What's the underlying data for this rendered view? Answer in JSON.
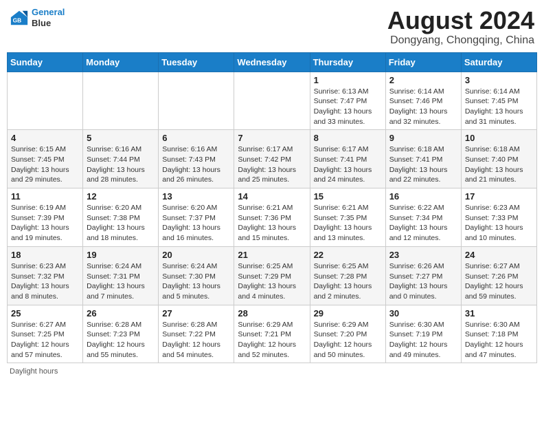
{
  "header": {
    "logo_line1": "General",
    "logo_line2": "Blue",
    "title": "August 2024",
    "subtitle": "Dongyang, Chongqing, China"
  },
  "days_of_week": [
    "Sunday",
    "Monday",
    "Tuesday",
    "Wednesday",
    "Thursday",
    "Friday",
    "Saturday"
  ],
  "footer": {
    "note": "Daylight hours"
  },
  "weeks": [
    [
      {
        "day": "",
        "info": ""
      },
      {
        "day": "",
        "info": ""
      },
      {
        "day": "",
        "info": ""
      },
      {
        "day": "",
        "info": ""
      },
      {
        "day": "1",
        "info": "Sunrise: 6:13 AM\nSunset: 7:47 PM\nDaylight: 13 hours and 33 minutes."
      },
      {
        "day": "2",
        "info": "Sunrise: 6:14 AM\nSunset: 7:46 PM\nDaylight: 13 hours and 32 minutes."
      },
      {
        "day": "3",
        "info": "Sunrise: 6:14 AM\nSunset: 7:45 PM\nDaylight: 13 hours and 31 minutes."
      }
    ],
    [
      {
        "day": "4",
        "info": "Sunrise: 6:15 AM\nSunset: 7:45 PM\nDaylight: 13 hours and 29 minutes."
      },
      {
        "day": "5",
        "info": "Sunrise: 6:16 AM\nSunset: 7:44 PM\nDaylight: 13 hours and 28 minutes."
      },
      {
        "day": "6",
        "info": "Sunrise: 6:16 AM\nSunset: 7:43 PM\nDaylight: 13 hours and 26 minutes."
      },
      {
        "day": "7",
        "info": "Sunrise: 6:17 AM\nSunset: 7:42 PM\nDaylight: 13 hours and 25 minutes."
      },
      {
        "day": "8",
        "info": "Sunrise: 6:17 AM\nSunset: 7:41 PM\nDaylight: 13 hours and 24 minutes."
      },
      {
        "day": "9",
        "info": "Sunrise: 6:18 AM\nSunset: 7:41 PM\nDaylight: 13 hours and 22 minutes."
      },
      {
        "day": "10",
        "info": "Sunrise: 6:18 AM\nSunset: 7:40 PM\nDaylight: 13 hours and 21 minutes."
      }
    ],
    [
      {
        "day": "11",
        "info": "Sunrise: 6:19 AM\nSunset: 7:39 PM\nDaylight: 13 hours and 19 minutes."
      },
      {
        "day": "12",
        "info": "Sunrise: 6:20 AM\nSunset: 7:38 PM\nDaylight: 13 hours and 18 minutes."
      },
      {
        "day": "13",
        "info": "Sunrise: 6:20 AM\nSunset: 7:37 PM\nDaylight: 13 hours and 16 minutes."
      },
      {
        "day": "14",
        "info": "Sunrise: 6:21 AM\nSunset: 7:36 PM\nDaylight: 13 hours and 15 minutes."
      },
      {
        "day": "15",
        "info": "Sunrise: 6:21 AM\nSunset: 7:35 PM\nDaylight: 13 hours and 13 minutes."
      },
      {
        "day": "16",
        "info": "Sunrise: 6:22 AM\nSunset: 7:34 PM\nDaylight: 13 hours and 12 minutes."
      },
      {
        "day": "17",
        "info": "Sunrise: 6:23 AM\nSunset: 7:33 PM\nDaylight: 13 hours and 10 minutes."
      }
    ],
    [
      {
        "day": "18",
        "info": "Sunrise: 6:23 AM\nSunset: 7:32 PM\nDaylight: 13 hours and 8 minutes."
      },
      {
        "day": "19",
        "info": "Sunrise: 6:24 AM\nSunset: 7:31 PM\nDaylight: 13 hours and 7 minutes."
      },
      {
        "day": "20",
        "info": "Sunrise: 6:24 AM\nSunset: 7:30 PM\nDaylight: 13 hours and 5 minutes."
      },
      {
        "day": "21",
        "info": "Sunrise: 6:25 AM\nSunset: 7:29 PM\nDaylight: 13 hours and 4 minutes."
      },
      {
        "day": "22",
        "info": "Sunrise: 6:25 AM\nSunset: 7:28 PM\nDaylight: 13 hours and 2 minutes."
      },
      {
        "day": "23",
        "info": "Sunrise: 6:26 AM\nSunset: 7:27 PM\nDaylight: 13 hours and 0 minutes."
      },
      {
        "day": "24",
        "info": "Sunrise: 6:27 AM\nSunset: 7:26 PM\nDaylight: 12 hours and 59 minutes."
      }
    ],
    [
      {
        "day": "25",
        "info": "Sunrise: 6:27 AM\nSunset: 7:25 PM\nDaylight: 12 hours and 57 minutes."
      },
      {
        "day": "26",
        "info": "Sunrise: 6:28 AM\nSunset: 7:23 PM\nDaylight: 12 hours and 55 minutes."
      },
      {
        "day": "27",
        "info": "Sunrise: 6:28 AM\nSunset: 7:22 PM\nDaylight: 12 hours and 54 minutes."
      },
      {
        "day": "28",
        "info": "Sunrise: 6:29 AM\nSunset: 7:21 PM\nDaylight: 12 hours and 52 minutes."
      },
      {
        "day": "29",
        "info": "Sunrise: 6:29 AM\nSunset: 7:20 PM\nDaylight: 12 hours and 50 minutes."
      },
      {
        "day": "30",
        "info": "Sunrise: 6:30 AM\nSunset: 7:19 PM\nDaylight: 12 hours and 49 minutes."
      },
      {
        "day": "31",
        "info": "Sunrise: 6:30 AM\nSunset: 7:18 PM\nDaylight: 12 hours and 47 minutes."
      }
    ]
  ]
}
